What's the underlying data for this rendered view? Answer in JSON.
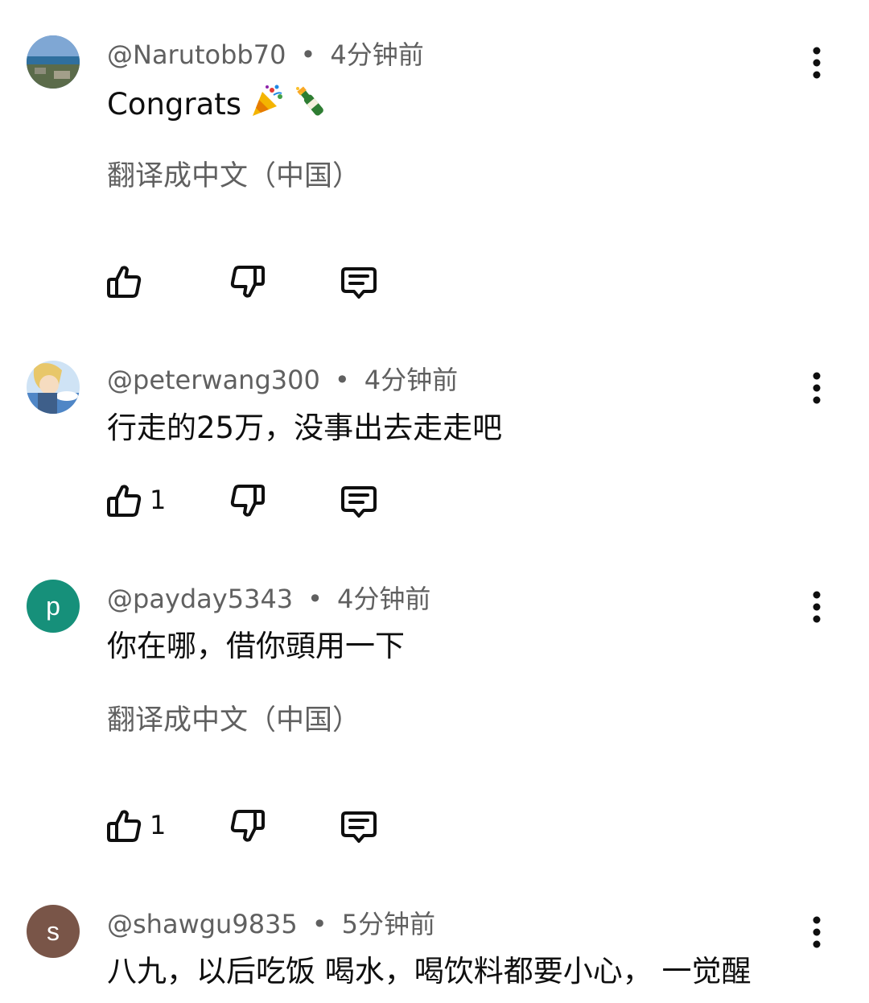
{
  "comments": [
    {
      "username": "@Narutobb70",
      "time": "4分钟前",
      "text": "Congrats",
      "translate": "翻译成中文（中国）",
      "likes": ""
    },
    {
      "username": "@peterwang300",
      "time": "4分钟前",
      "text": "行走的25万，没事出去走走吧",
      "likes": "1"
    },
    {
      "username": "@payday5343",
      "time": "4分钟前",
      "text": "你在哪，借你頭用一下",
      "translate": "翻译成中文（中国）",
      "likes": "1",
      "avatar_letter": "p",
      "avatar_color": "#16907a"
    },
    {
      "username": "@shawgu9835",
      "time": "5分钟前",
      "text": "八九，以后吃饭 喝水，喝饮料都要小心， 一觉醒",
      "avatar_letter": "s",
      "avatar_color": "#795548"
    }
  ],
  "separator": "•",
  "icons": {
    "like": "thumb-up-icon",
    "dislike": "thumb-down-icon",
    "reply": "reply-comment-icon",
    "more": "more-vert-icon",
    "emoji1": "party-popper-emoji",
    "emoji2": "champagne-emoji"
  }
}
